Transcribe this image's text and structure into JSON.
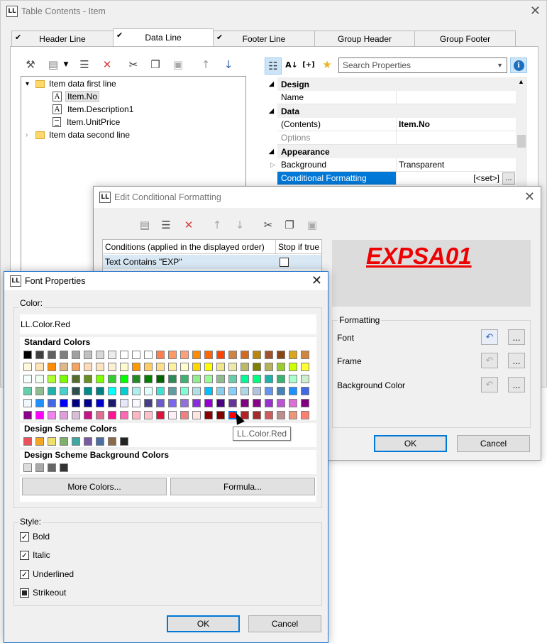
{
  "main_window": {
    "title": "Table Contents - Item",
    "tabs": [
      "Header Line",
      "Data Line",
      "Footer Line",
      "Group Header",
      "Group Footer"
    ],
    "active_tab": "Data Line"
  },
  "tree": {
    "items": [
      {
        "label": "Item data first line"
      },
      {
        "label": "Item.No"
      },
      {
        "label": "Item.Description1"
      },
      {
        "label": "Item.UnitPrice"
      },
      {
        "label": "Item data second line"
      }
    ]
  },
  "search": {
    "placeholder": "Search Properties"
  },
  "properties": {
    "cat_design": "Design",
    "name_label": "Name",
    "cat_data": "Data",
    "contents_label": "(Contents)",
    "contents_value": "Item.No",
    "options_label": "Options",
    "cat_appearance": "Appearance",
    "background_label": "Background",
    "background_value": "Transparent",
    "cond_label": "Conditional Formatting",
    "cond_value": "[<set>]",
    "more": "..."
  },
  "cond_dialog": {
    "title": "Edit Conditional Formatting",
    "col_conditions": "Conditions (applied in the displayed order)",
    "col_stop": "Stop if true",
    "condition_text": "Text Contains \"EXP\"",
    "preview_text": "EXPSA01",
    "preview_color": "#ee0000",
    "formatting_label": "Formatting",
    "font_label": "Font",
    "frame_label": "Frame",
    "bgcolor_label": "Background Color",
    "ellipsis": "...",
    "ok": "OK",
    "cancel": "Cancel"
  },
  "font_dialog": {
    "title": "Font Properties",
    "color_label": "Color:",
    "color_value": "LL.Color.Red",
    "standard_colors": "Standard Colors",
    "design_scheme": "Design Scheme Colors",
    "design_scheme_bg": "Design Scheme Background Colors",
    "more_colors": "More Colors...",
    "formula": "Formula...",
    "tooltip": "LL.Color.Red",
    "style_label": "Style:",
    "bold": "Bold",
    "italic": "Italic",
    "underlined": "Underlined",
    "strikeout": "Strikeout",
    "ok": "OK",
    "cancel": "Cancel"
  },
  "palette": {
    "rows": [
      [
        "#000000",
        "#404040",
        "#606060",
        "#808080",
        "#a0a0a0",
        "#c0c0c0",
        "#d8d8d8",
        "#ececec",
        "#ffffff",
        "#ffffff",
        "#ffffff",
        "#ff7f50",
        "#ff9966",
        "#ffa07a",
        "#ff8c00",
        "#ff6600",
        "#ff4500",
        "#cd853f",
        "#d2691e",
        "#b8860b",
        "#a0522d",
        "#8b4513",
        "#daa520",
        "#cd853f"
      ],
      [
        "#fff8dc",
        "#ffe4b5",
        "#ff8c00",
        "#deb887",
        "#f4a460",
        "#ffdab9",
        "#ffe4c4",
        "#ffefd5",
        "#fffacd",
        "#ff9900",
        "#ffcc66",
        "#ffe08a",
        "#fff0a0",
        "#ffffcc",
        "#ffd700",
        "#ffff00",
        "#f0e68c",
        "#eee8aa",
        "#bdb76b",
        "#808000",
        "#b5b35c",
        "#9acd32",
        "#ccff00",
        "#ffff33"
      ],
      [
        "#f5fffa",
        "#f0fff0",
        "#adff2f",
        "#7cfc00",
        "#556b2f",
        "#6b8e23",
        "#7fff00",
        "#32cd32",
        "#00ff00",
        "#228b22",
        "#008000",
        "#006400",
        "#2e8b57",
        "#3cb371",
        "#90ee90",
        "#98fb98",
        "#8fbc8f",
        "#66cdaa",
        "#00fa9a",
        "#00ff7f",
        "#20b2aa",
        "#3cb371",
        "#aaffcc",
        "#cceecc"
      ],
      [
        "#66cdaa",
        "#8fbc8f",
        "#20b2aa",
        "#48d1cc",
        "#2f4f4f",
        "#008b8b",
        "#008080",
        "#00ffff",
        "#00ced1",
        "#afeeee",
        "#e0ffff",
        "#40e0d0",
        "#5f9ea0",
        "#7fffd4",
        "#b0e0e6",
        "#00bfff",
        "#87ceeb",
        "#87cefa",
        "#add8e6",
        "#b0c4de",
        "#6495ed",
        "#4682b4",
        "#1e90ff",
        "#4169e1"
      ],
      [
        "#f0f8ff",
        "#1e90ff",
        "#4169e1",
        "#0000ff",
        "#000080",
        "#00008b",
        "#0000cd",
        "#191970",
        "#e6e6fa",
        "#f8f8ff",
        "#483d8b",
        "#6a5acd",
        "#7b68ee",
        "#9370db",
        "#8a2be2",
        "#9400d3",
        "#4b0082",
        "#663399",
        "#800080",
        "#8b008b",
        "#9932cc",
        "#ba55d3",
        "#da70d6",
        "#800080"
      ],
      [
        "#8b008b",
        "#ff00ff",
        "#ee82ee",
        "#dda0dd",
        "#d8bfd8",
        "#c71585",
        "#db7093",
        "#ff1493",
        "#ff69b4",
        "#ffb6c1",
        "#ffc0cb",
        "#dc143c",
        "#fff0f5",
        "#f08080",
        "#ffe4e1",
        "#8b0000",
        "#800000",
        "#ff0000",
        "#b22222",
        "#a52a2a",
        "#cd5c5c",
        "#bc8f8f",
        "#e9967a",
        "#fa8072"
      ]
    ],
    "selected_row": 5,
    "selected_col": 17,
    "scheme": [
      "#e8535a",
      "#f5a623",
      "#f0e06a",
      "#7fb069",
      "#3fa7a1",
      "#7a5aa0",
      "#4a6fa5",
      "#8c6b4a",
      "#222222"
    ],
    "scheme_bg": [
      "#dddddd",
      "#aaaaaa",
      "#666666",
      "#333333"
    ]
  }
}
